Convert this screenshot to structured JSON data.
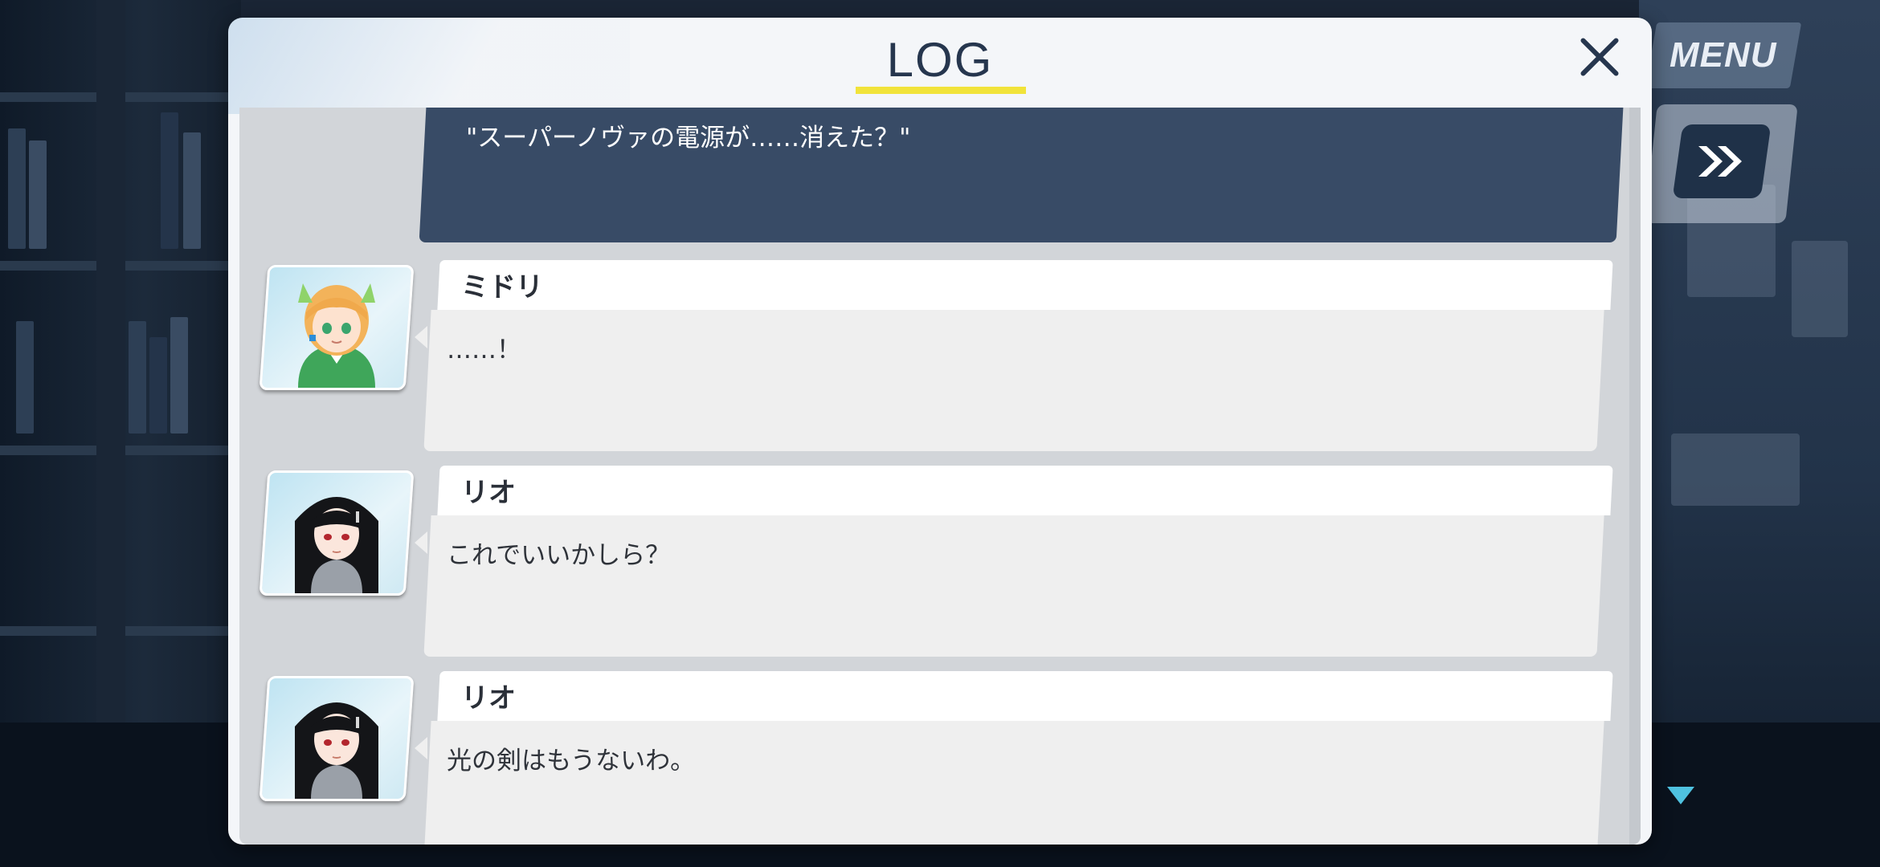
{
  "window": {
    "title": "LOG"
  },
  "hud": {
    "menu_label": "MENU",
    "skip_icon": "fast-forward-icon",
    "scroll_indicator_icon": "triangle-down-icon"
  },
  "log": {
    "close_icon": "close-icon",
    "narration": {
      "text": "\"スーパーノヴァの電源が……消えた？\""
    },
    "entries": [
      {
        "speaker": "ミドリ",
        "text": "……！",
        "avatar": "midori-portrait"
      },
      {
        "speaker": "リオ",
        "text": "これでいいかしら？",
        "avatar": "rio-portrait"
      },
      {
        "speaker": "リオ",
        "text": "光の剣はもうないわ。",
        "avatar": "rio-portrait"
      }
    ]
  },
  "colors": {
    "panel_bg": "#f4f6f9",
    "title_text": "#26364e",
    "title_underline": "#f1e33a",
    "narration_bg": "#384b66",
    "dialogue_bg": "#efefef",
    "accent_arrow": "#4fc2e0"
  }
}
